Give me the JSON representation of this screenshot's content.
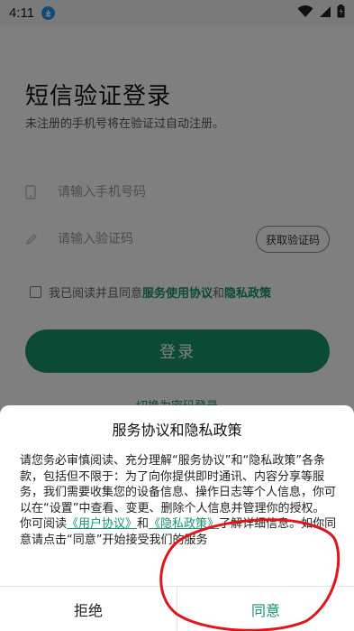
{
  "status_bar": {
    "time": "4:11"
  },
  "login": {
    "title": "短信验证登录",
    "subtitle": "未注册的手机号将在验证过自动注册。",
    "phone_placeholder": "请输入手机号码",
    "code_placeholder": "请输入验证码",
    "get_code_label": "获取验证码",
    "agree_prefix": "我已阅读并且同意",
    "agree_service_link": "服务使用协议",
    "agree_and": "和",
    "agree_privacy_link": "隐私政策",
    "login_label": "登录",
    "switch_label": "切换为密码登录"
  },
  "dialog": {
    "title": "服务协议和隐私政策",
    "para1": "请您务必审慎阅读、充分理解“服务协议”和“隐私政策”各条款，包括但不限于：为了向你提供即时通讯、内容分享等服务，我们需要收集您的设备信息、操作日志等个人信息，你可以在“设置”中查看、变更、删除个人信息并管理你的授权。",
    "para2_prefix": "你可阅读",
    "user_agreement_link": "《用户协议》",
    "para2_and": "和",
    "privacy_link": "《隐私政策》",
    "para2_suffix": "了解详细信息。如你同意请点击“同意”开始接受我们的服务",
    "refuse_label": "拒绝",
    "agree_label": "同意"
  },
  "colors": {
    "accent": "#17946b",
    "annotation": "#e0161b",
    "download_badge": "#2196f3"
  },
  "icons": {
    "download": "download-icon",
    "wifi": "wifi-icon",
    "signal": "signal-icon",
    "battery": "battery-icon",
    "phone": "phone-icon",
    "code": "pencil-icon"
  }
}
